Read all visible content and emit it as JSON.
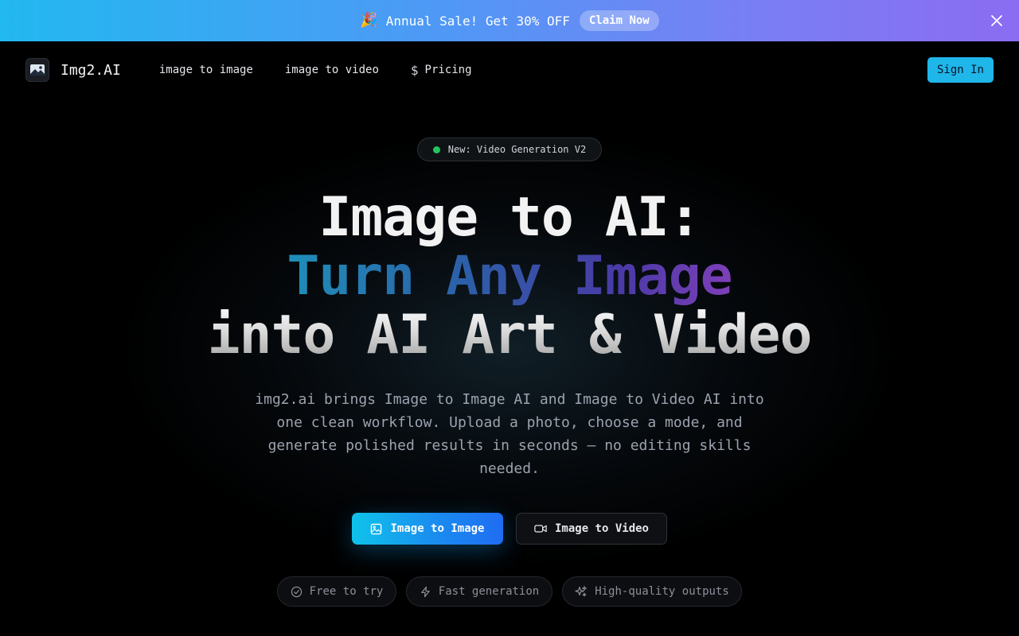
{
  "banner": {
    "emoji": "🎉",
    "text": "Annual Sale! Get 30% OFF",
    "cta_label": "Claim Now",
    "close_icon": "close-icon"
  },
  "nav": {
    "brand": "Img2.AI",
    "links": [
      {
        "label": "image to image"
      },
      {
        "label": "image to video"
      },
      {
        "label": "Pricing",
        "icon": "dollar-icon",
        "glyph": "$"
      }
    ],
    "signin_label": "Sign In"
  },
  "hero": {
    "badge": "New: Video Generation V2",
    "title_line1": "Image to AI:",
    "title_line2": "Turn Any Image",
    "title_line3": "into AI Art & Video",
    "subtitle": "img2.ai brings Image to Image AI and Image to Video AI into one clean workflow. Upload a photo, choose a mode, and generate polished results in seconds — no editing skills needed.",
    "cta_primary": "Image to Image",
    "cta_secondary": "Image to Video"
  },
  "features": [
    {
      "label": "Free to try",
      "icon": "check-circle-icon"
    },
    {
      "label": "Fast generation",
      "icon": "lightning-icon"
    },
    {
      "label": "High-quality outputs",
      "icon": "sparkles-icon"
    }
  ],
  "colors": {
    "accent": "#1fb6ea",
    "badge_dot": "#22c55e",
    "banner_start": "#22b8f0",
    "banner_end": "#8b6cf2"
  }
}
